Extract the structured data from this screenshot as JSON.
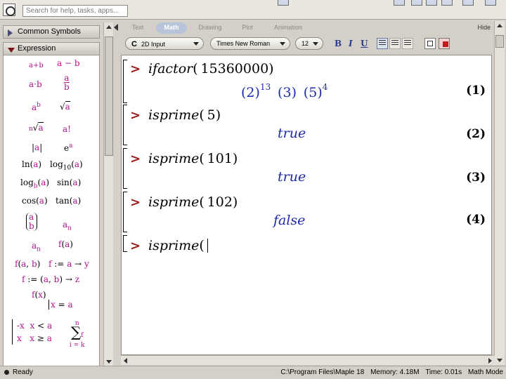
{
  "search": {
    "placeholder": "Search for help, tasks, apps..."
  },
  "palette": {
    "common_symbols": "Common Symbols",
    "expression": "Expression"
  },
  "tabs": [
    {
      "label": "Text"
    },
    {
      "label": "Math"
    },
    {
      "label": "Drawing"
    },
    {
      "label": "Plot"
    },
    {
      "label": "Animation"
    }
  ],
  "hide_label": "Hide",
  "format": {
    "mode_letter": "C",
    "mode": "2D Input",
    "font": "Times New Roman",
    "size": "12",
    "bold": "B",
    "italic": "I",
    "underline": "U"
  },
  "worksheet": {
    "commands": [
      {
        "fn": "ifactor",
        "arg": "15360000",
        "label": "(1)"
      },
      {
        "fn": "isprime",
        "arg": "5",
        "result": "true",
        "label": "(2)"
      },
      {
        "fn": "isprime",
        "arg": "101",
        "result": "true",
        "label": "(3)"
      },
      {
        "fn": "isprime",
        "arg": "102",
        "result": "false",
        "label": "(4)"
      },
      {
        "fn": "isprime"
      }
    ],
    "factor_terms": [
      {
        "base": "2",
        "exp": "13"
      },
      {
        "base": "3",
        "exp": ""
      },
      {
        "base": "5",
        "exp": "4"
      }
    ]
  },
  "status": {
    "ready": "Ready",
    "path": "C:\\Program Files\\Maple 18",
    "memory": "Memory: 4.18M",
    "time": "Time: 0.01s",
    "mode": "Math Mode"
  },
  "colors": {
    "prompt": "#9b1c1c",
    "output": "#1e2aa8",
    "palette_symbol": "#b1128f"
  }
}
